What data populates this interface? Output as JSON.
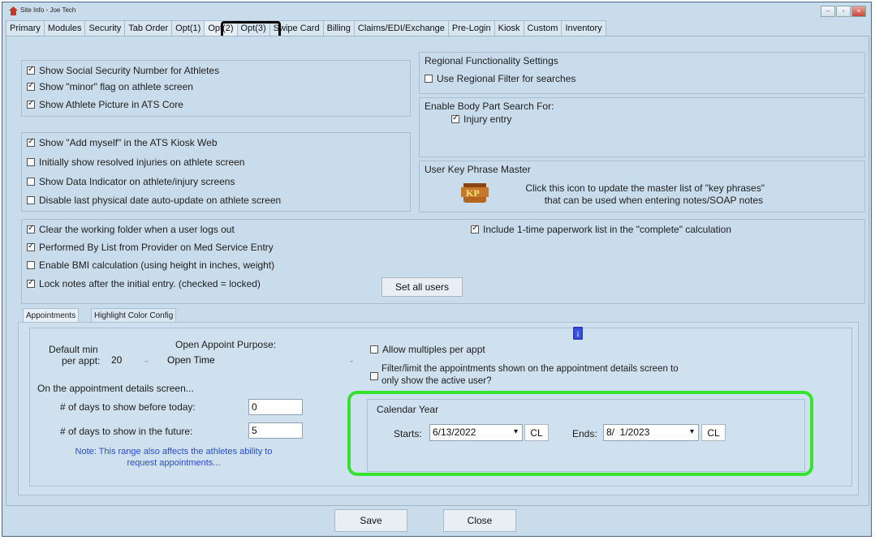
{
  "window": {
    "title": "Site Info - Joe Tech"
  },
  "tabs": [
    "Primary",
    "Modules",
    "Security",
    "Tab Order",
    "Opt(1)",
    "Opt(2)",
    "Opt(3)",
    "Swipe Card",
    "Billing",
    "Claims/EDI/Exchange",
    "Pre-Login",
    "Kiosk",
    "Custom",
    "Inventory"
  ],
  "left_options": [
    {
      "label": "Show Social Security Number for Athletes",
      "checked": true
    },
    {
      "label": "Show \"minor\" flag on athlete screen",
      "checked": true
    },
    {
      "label": "Show Athlete Picture in ATS Core",
      "checked": true
    },
    {
      "label": "Show \"Add myself\" in the ATS Kiosk Web",
      "checked": true
    },
    {
      "label": "Initially show resolved injuries on athlete screen",
      "checked": false
    },
    {
      "label": "Show Data Indicator on athlete/injury screens",
      "checked": false
    },
    {
      "label": "Disable last physical date auto-update on athlete screen",
      "checked": false
    },
    {
      "label": "Clear the working folder when a user logs out",
      "checked": true
    },
    {
      "label": "Performed By List from Provider on Med Service Entry",
      "checked": true
    },
    {
      "label": "Enable BMI calculation (using height in inches, weight)",
      "checked": false
    },
    {
      "label": "Lock notes after the initial entry.  (checked = locked)",
      "checked": true
    }
  ],
  "regional": {
    "title": "Regional Functionality Settings",
    "option": "Use Regional Filter for searches"
  },
  "body_part": {
    "title": "Enable Body Part Search For:",
    "option": "Injury entry"
  },
  "key_phrase": {
    "title": "User Key Phrase Master",
    "icon_text": "KP",
    "desc_line1": "Click this icon to update the master list of \"key phrases\"",
    "desc_line2": "that can be used when entering notes/SOAP notes"
  },
  "paperwork": "Include 1-time paperwork list in the \"complete\" calculation",
  "set_all_users": "Set all users",
  "subtabs": [
    "Appointments",
    "Highlight Color Config"
  ],
  "appointments": {
    "default_min_label1": "Default min",
    "default_min_label2": "per appt:",
    "default_min_value": "20",
    "purpose_label": "Open Appoint Purpose:",
    "purpose_value": "Open Time",
    "allow_multiples": "Allow multiples per appt",
    "filter_line1": "Filter/limit the appointments shown on the appointment details screen to",
    "filter_line2": "only show the active user?",
    "details_label": "On the appointment details screen...",
    "days_before_label": "# of days to show before today:",
    "days_before_value": "0",
    "days_future_label": "# of days to show in the future:",
    "days_future_value": "5",
    "note_line1": "Note:  This range also affects the athletes ability to",
    "note_line2": "request appointments..."
  },
  "calendar": {
    "title": "Calendar Year",
    "starts_label": "Starts:",
    "starts_value": "6/13/2022",
    "ends_label": "Ends:",
    "ends_value": "8/  1/2023",
    "cl": "CL"
  },
  "footer": {
    "save": "Save",
    "close": "Close"
  },
  "colors": {
    "highlight_green": "#35e32f",
    "panel": "#c9dcec",
    "note_blue": "#2a4bd6"
  }
}
